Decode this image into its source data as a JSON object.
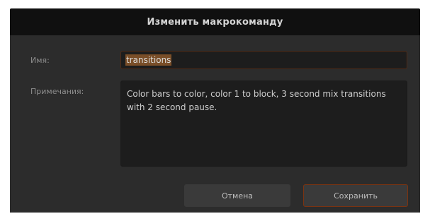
{
  "dialog": {
    "title": "Изменить макрокоманду",
    "name_label": "Имя:",
    "name_value": "transitions",
    "notes_label": "Примечания:",
    "notes_value": "Color bars to color, color 1 to block, 3 second mix transitions with 2 second pause.",
    "cancel_label": "Отмена",
    "save_label": "Сохранить"
  },
  "colors": {
    "title_bar": "#101010",
    "body": "#2c2c2c",
    "field_background": "#1d1d1d",
    "focus_accent": "#7a3311",
    "selection": "#7a4e28"
  }
}
